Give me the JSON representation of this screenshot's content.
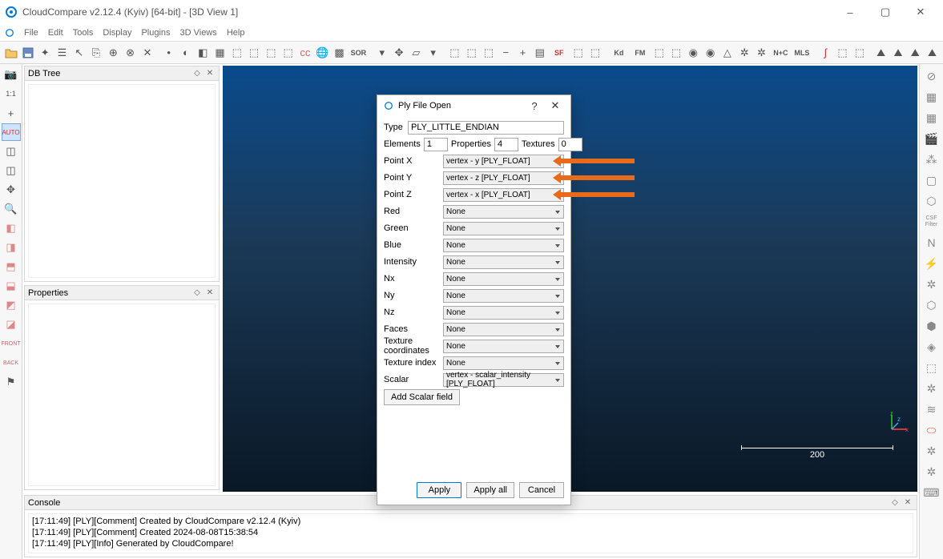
{
  "window": {
    "title": "CloudCompare v2.12.4 (Kyiv) [64-bit] - [3D View 1]",
    "minimize": "–",
    "maximize": "▢",
    "close": "✕"
  },
  "menubar": [
    "File",
    "Edit",
    "Tools",
    "Display",
    "Plugins",
    "3D Views",
    "Help"
  ],
  "panels": {
    "dbtree": "DB Tree",
    "properties": "Properties",
    "console": "Console"
  },
  "console_lines": [
    "[17:11:49] [PLY][Comment] Created by CloudCompare v2.12.4 (Kyiv)",
    "[17:11:49] [PLY][Comment] Created 2024-08-08T15:38:54",
    "[17:11:49] [PLY][Info] Generated by CloudCompare!"
  ],
  "viewport": {
    "scale_label": "200",
    "axes": {
      "x": "x",
      "y": "y",
      "z": "z"
    }
  },
  "dialog": {
    "title": "Ply File Open",
    "help": "?",
    "close": "✕",
    "type_label": "Type",
    "type_value": "PLY_LITTLE_ENDIAN",
    "elements_label": "Elements",
    "elements_value": "1",
    "properties_label": "Properties",
    "properties_value": "4",
    "textures_label": "Textures",
    "textures_value": "0",
    "rows": [
      {
        "label": "Point X",
        "value": "vertex - y [PLY_FLOAT]",
        "arrow": true
      },
      {
        "label": "Point Y",
        "value": "vertex - z [PLY_FLOAT]",
        "arrow": true
      },
      {
        "label": "Point Z",
        "value": "vertex - x [PLY_FLOAT]",
        "arrow": true
      },
      {
        "label": "Red",
        "value": "None"
      },
      {
        "label": "Green",
        "value": "None"
      },
      {
        "label": "Blue",
        "value": "None"
      },
      {
        "label": "Intensity",
        "value": "None"
      },
      {
        "label": "Nx",
        "value": "None"
      },
      {
        "label": "Ny",
        "value": "None"
      },
      {
        "label": "Nz",
        "value": "None"
      },
      {
        "label": "Faces",
        "value": "None"
      },
      {
        "label": "Texture coordinates",
        "value": "None"
      },
      {
        "label": "Texture index",
        "value": "None"
      },
      {
        "label": "Scalar",
        "value": "vertex - scalar_intensity [PLY_FLOAT]"
      }
    ],
    "add_scalar": "Add Scalar field",
    "apply": "Apply",
    "apply_all": "Apply all",
    "cancel": "Cancel"
  },
  "toolbar_text": {
    "sor": "SOR",
    "sf": "SF",
    "kd": "Kd",
    "fm": "FM",
    "nc": "N+C",
    "mls": "MLS",
    "csf": "CSF Filter"
  }
}
